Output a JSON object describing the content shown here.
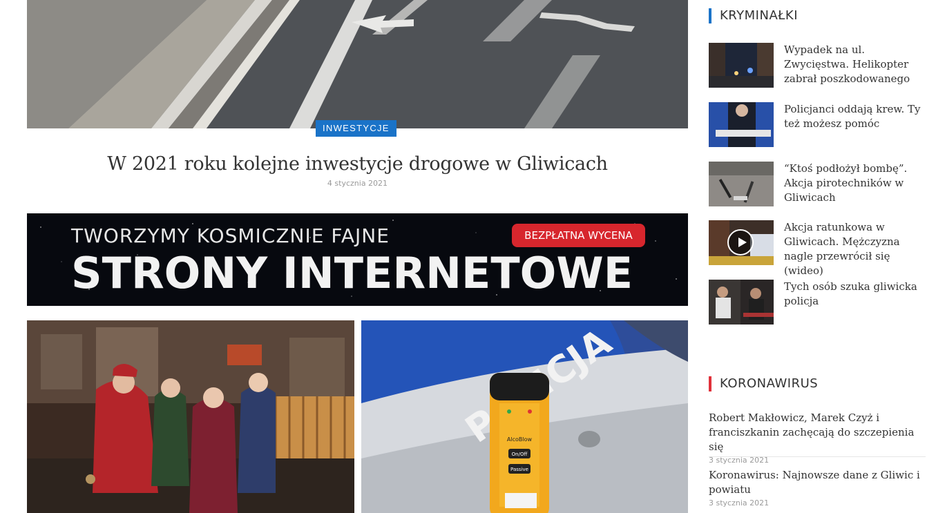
{
  "main": {
    "featured": {
      "category": "INWESTYCJE",
      "title": "W 2021 roku kolejne inwestycje drogowe w Gliwicach",
      "date": "4 stycznia 2021"
    },
    "ad": {
      "line1": "TWORZYMY KOSMICZNIE FAJNE",
      "line2": "STRONY INTERNETOWE",
      "button": "BEZPŁATNA WYCENA"
    },
    "tiles": [
      {
        "image": "carolers-photo"
      },
      {
        "image": "police-breathalyzer-photo",
        "car_text": "POLICJA",
        "device_brand": "AlcoBlow",
        "device_button": "On/Off",
        "device_mode": "Passive"
      }
    ]
  },
  "sidebar": {
    "kryminalki": {
      "title": "KRYMINAŁKI",
      "accent": "#1a73c8",
      "items": [
        {
          "title": "Wypadek na ul. Zwycięstwa. Helikopter zabrał poszkodowanego"
        },
        {
          "title": "Policjanci oddają krew. Ty też możesz pomóc"
        },
        {
          "title": "“Ktoś podłożył bombę”. Akcja pirotechników w Gliwicach"
        },
        {
          "title": "Akcja ratunkowa w Gliwicach. Mężczyzna nagle przewrócił się (wideo)",
          "icon": "play-icon"
        },
        {
          "title": "Tych osób szuka gliwicka policja"
        }
      ]
    },
    "koronawirus": {
      "title": "KORONAWIRUS",
      "accent": "#e0303a",
      "items": [
        {
          "title": "Robert Makłowicz, Marek Czyż i franciszkanin zachęcają do szczepienia się",
          "date": "3 stycznia 2021"
        },
        {
          "title": "Koronawirus: Najnowsze dane z Gliwic i powiatu",
          "date": "3 stycznia 2021"
        }
      ]
    }
  },
  "colors": {
    "badge": "#1a73c8",
    "ad_button": "#d7262d",
    "text": "#333333",
    "muted": "#9a9a9a"
  }
}
